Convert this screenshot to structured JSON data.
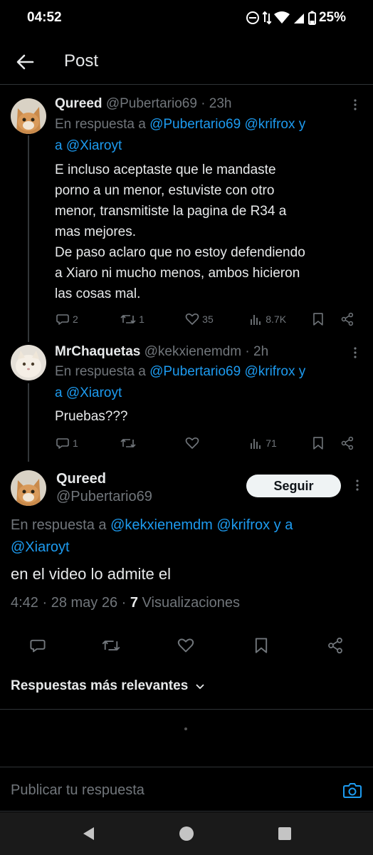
{
  "status_bar": {
    "time": "04:52",
    "battery": "25%"
  },
  "header": {
    "title": "Post"
  },
  "thread": [
    {
      "name": "Qureed",
      "handle": "@Pubertario69",
      "time": "· 23h",
      "reply_prefix": "En respuesta a ",
      "reply_mentions_1": "@Pubertario69 @krifrox y",
      "reply_mentions_2": "a @Xiaroyt",
      "text_lines": [
        "E incluso aceptaste que le mandaste",
        "porno a un menor, estuviste con otro",
        "menor, transmitiste la pagina de R34 a",
        "mas mejores.",
        "De paso aclaro que no estoy defendiendo",
        "a Xiaro ni mucho menos, ambos hicieron",
        "las cosas mal."
      ],
      "replies": "2",
      "retweets": "1",
      "likes": "35",
      "views": "8.7K"
    },
    {
      "name": "MrChaquetas",
      "handle": "@kekxienemdm",
      "time": "· 2h",
      "reply_prefix": "En respuesta a ",
      "reply_mentions_1": "@Pubertario69 @krifrox y",
      "reply_mentions_2": "a @Xiaroyt",
      "text_lines": [
        "Pruebas???"
      ],
      "replies": "1",
      "retweets": "",
      "likes": "",
      "views": "71"
    }
  ],
  "main_post": {
    "name": "Qureed",
    "handle": "@Pubertario69",
    "follow_label": "Seguir",
    "reply_prefix": "En respuesta a ",
    "reply_mentions_1": "@kekxienemdm @krifrox y a",
    "reply_mentions_2": "@Xiaroyt",
    "text": "en el video lo admite el",
    "timestamp": "4:42 · 28 may 26 · ",
    "view_count": "7",
    "views_label": " Visualizaciones"
  },
  "sort": {
    "label": "Respuestas más relevantes"
  },
  "composer": {
    "placeholder": "Publicar tu respuesta"
  },
  "colors": {
    "accent": "#1d9bf0",
    "muted": "#71767b",
    "background": "#000000"
  }
}
